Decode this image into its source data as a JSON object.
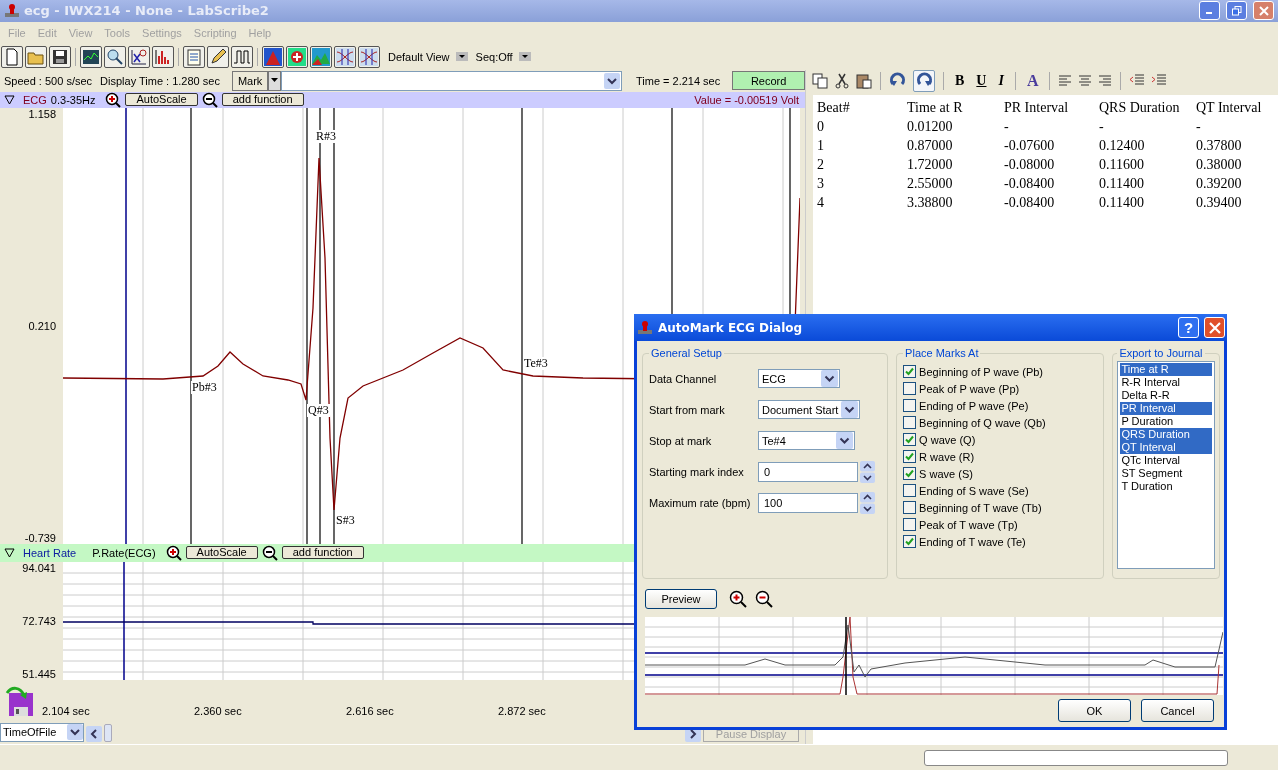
{
  "window": {
    "title": "ecg - IWX214 - None - LabScribe2"
  },
  "menu": [
    "File",
    "Edit",
    "View",
    "Tools",
    "Settings",
    "Scripting",
    "Help"
  ],
  "toolbar": {
    "view": "Default View",
    "sequence": "Seq:Off"
  },
  "info_bar": {
    "speed": "Speed : 500 s/sec",
    "display_time": "Display Time : 1.280 sec",
    "mark": "Mark",
    "time": "Time = 2.214 sec",
    "record": "Record"
  },
  "ecg_channel": {
    "name": "ECG",
    "filter": "0.3-35Hz",
    "autoscale": "AutoScale",
    "add_function": "add function",
    "value": "Value = -0.00519 Volt",
    "y_labels": [
      "1.158",
      "0.210",
      "-0.739"
    ],
    "marks": [
      "R#3",
      "Pb#3",
      "Q#3",
      "S#3",
      "Te#3"
    ]
  },
  "rate_channel": {
    "name": "Heart Rate",
    "function": "P.Rate(ECG)",
    "autoscale": "AutoScale",
    "add_function": "add function",
    "y_labels": [
      "94.041",
      "72.743",
      "51.445"
    ]
  },
  "time_axis": [
    "2.104 sec",
    "2.360 sec",
    "2.616 sec",
    "2.872 sec"
  ],
  "time_format": "TimeOfFile",
  "pause": {
    "label": "Pause Display",
    "disabled": true
  },
  "journal": {
    "format_buttons": [
      {
        "label": "B",
        "kind": "bold"
      },
      {
        "label": "U",
        "kind": "underline"
      },
      {
        "label": "I",
        "kind": "italic"
      }
    ],
    "font_color": "A",
    "columns": [
      "Beat#",
      "Time at R",
      "PR Interval",
      "QRS Duration",
      "QT Interval"
    ],
    "rows": [
      [
        "0",
        "0.01200",
        "-",
        "-",
        "-"
      ],
      [
        "1",
        "0.87000",
        "-0.07600",
        "0.12400",
        "0.37800"
      ],
      [
        "2",
        "1.72000",
        "-0.08000",
        "0.11600",
        "0.38000"
      ],
      [
        "3",
        "2.55000",
        "-0.08400",
        "0.11400",
        "0.39200"
      ],
      [
        "4",
        "3.38800",
        "-0.08400",
        "0.11400",
        "0.39400"
      ]
    ]
  },
  "dialog": {
    "title": "AutoMark ECG Dialog",
    "help": "?",
    "general_setup": {
      "title": "General Setup",
      "fields": [
        {
          "label": "Data Channel",
          "kind": "dropdown",
          "value": "ECG"
        },
        {
          "label": "Start from mark",
          "kind": "dropdown",
          "value": "Document Start"
        },
        {
          "label": "Stop at mark",
          "kind": "dropdown",
          "value": "Te#4"
        },
        {
          "label": "Starting mark index",
          "kind": "spin",
          "value": "0"
        },
        {
          "label": "Maximum rate (bpm)",
          "kind": "spin",
          "value": "100"
        }
      ]
    },
    "place_marks": {
      "title": "Place Marks At",
      "items": [
        {
          "label": "Beginning of P wave (Pb)",
          "checked": true
        },
        {
          "label": "Peak of P wave (Pp)",
          "checked": false
        },
        {
          "label": "Ending of P wave (Pe)",
          "checked": false
        },
        {
          "label": "Beginning of Q wave (Qb)",
          "checked": false
        },
        {
          "label": "Q wave (Q)",
          "checked": true
        },
        {
          "label": "R wave (R)",
          "checked": true
        },
        {
          "label": "S wave (S)",
          "checked": true
        },
        {
          "label": "Ending of S wave (Se)",
          "checked": false
        },
        {
          "label": "Beginning of T wave (Tb)",
          "checked": false
        },
        {
          "label": "Peak of T wave (Tp)",
          "checked": false
        },
        {
          "label": "Ending of T wave (Te)",
          "checked": true
        }
      ]
    },
    "export": {
      "title": "Export to Journal",
      "items": [
        {
          "label": "Time at R",
          "selected": true
        },
        {
          "label": "R-R Interval",
          "selected": false
        },
        {
          "label": "Delta R-R",
          "selected": false
        },
        {
          "label": "PR Interval",
          "selected": true
        },
        {
          "label": "P Duration",
          "selected": false
        },
        {
          "label": "QRS Duration",
          "selected": true
        },
        {
          "label": "QT Interval",
          "selected": true
        },
        {
          "label": "QTc Interval",
          "selected": false
        },
        {
          "label": "ST Segment",
          "selected": false
        },
        {
          "label": "T Duration",
          "selected": false
        }
      ]
    },
    "preview": "Preview",
    "buttons": [
      "OK",
      "Cancel"
    ]
  }
}
